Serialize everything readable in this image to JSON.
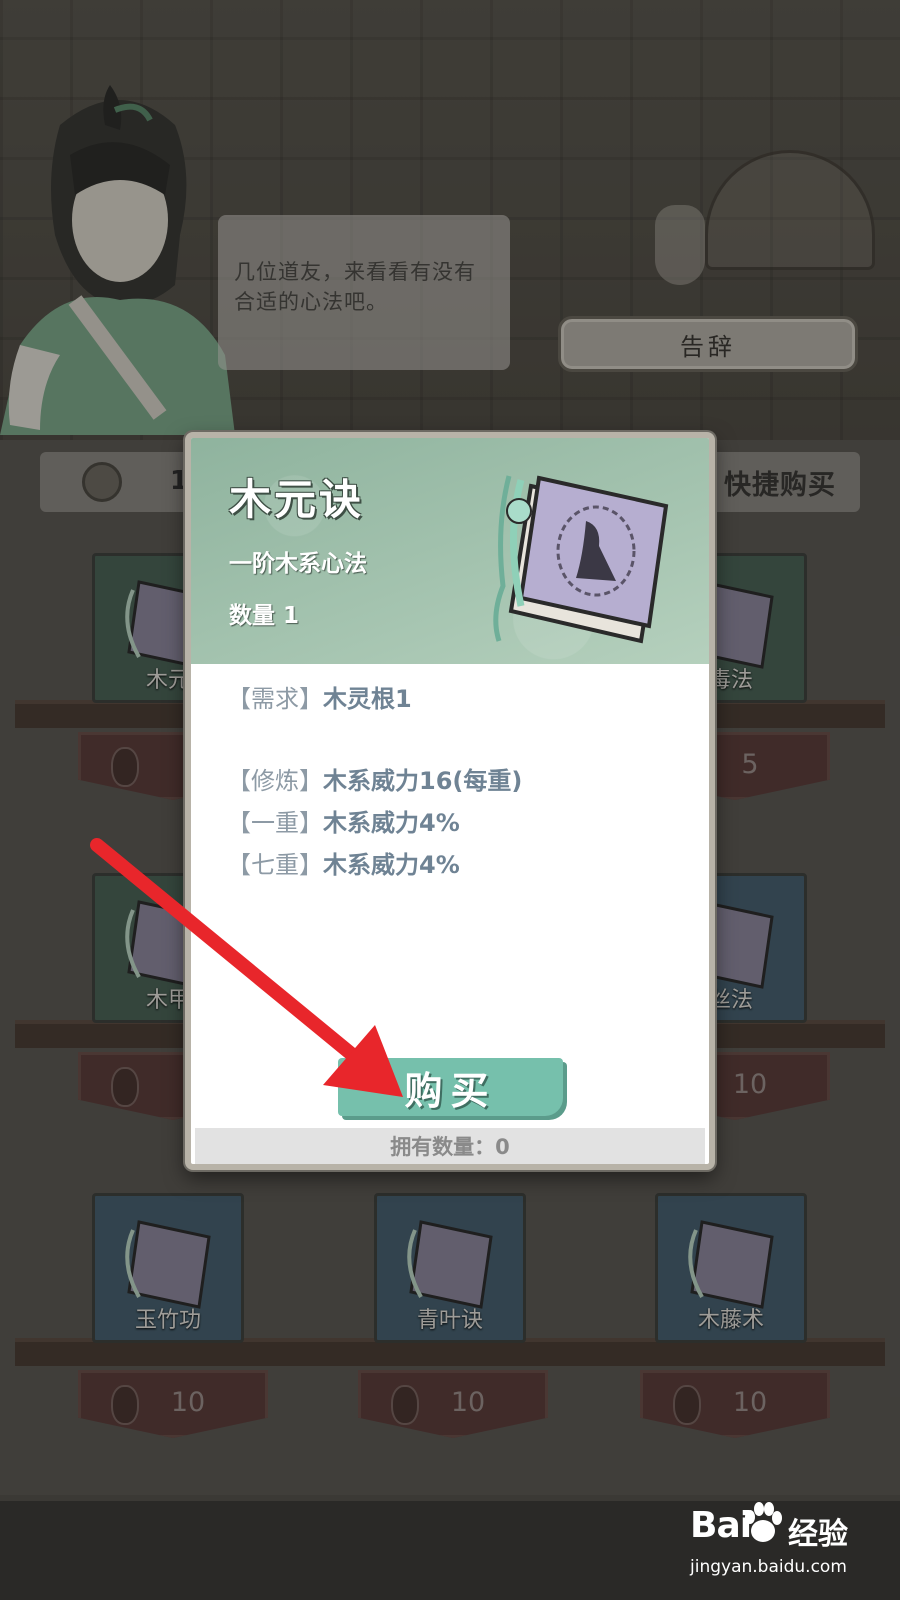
{
  "npc": {
    "dialogue": "几位道友，来看看有没有合适的心法吧。"
  },
  "header": {
    "leave_label": "告辞",
    "currency_value": "1",
    "quickbuy_label": "快捷购买"
  },
  "shop_items": [
    {
      "name": "木元",
      "price": "",
      "slot_color": "green"
    },
    {
      "name": "毒法",
      "price": "5",
      "slot_color": "green"
    },
    {
      "name": "木甲",
      "price": "",
      "slot_color": "green"
    },
    {
      "name": "丝法",
      "price": "10",
      "slot_color": "blue"
    },
    {
      "name": "玉竹功",
      "price": "10",
      "slot_color": "blue"
    },
    {
      "name": "青叶诀",
      "price": "10",
      "slot_color": "blue"
    },
    {
      "name": "木藤术",
      "price": "10",
      "slot_color": "blue"
    }
  ],
  "modal": {
    "title": "木元诀",
    "subtitle": "一阶木系心法",
    "quantity_label": "数量 1",
    "stats": [
      {
        "tag": "【需求】",
        "text": "木灵根1"
      },
      {
        "tag": "【修炼】",
        "text": "木系威力16(每重)"
      },
      {
        "tag": "【一重】",
        "text": "木系威力4%"
      },
      {
        "tag": "【七重】",
        "text": "木系威力4%"
      }
    ],
    "buy_label": "购买",
    "owned_label": "拥有数量：0"
  },
  "watermark": {
    "logo": "Bai",
    "label": "经验",
    "url": "jingyan.baidu.com"
  },
  "colors": {
    "modal_header": "#a5c4b0",
    "buy_button": "#76c0ac",
    "stat_text": "#6f8394",
    "arrow": "#e8262b"
  }
}
